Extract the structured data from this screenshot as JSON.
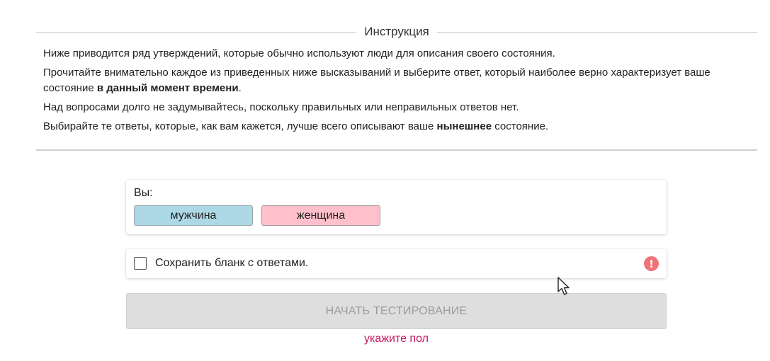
{
  "top_partial_text": "",
  "instruction": {
    "legend": "Инструкция",
    "p1": "Ниже приводится ряд утверждений, которые обычно используют люди для описания своего состояния.",
    "p2_before": "Прочитайте внимательно каждое из приведенных ниже высказываний и выберите ответ, который наиболее верно характеризует ваше состояние ",
    "p2_bold": "в данный момент времени",
    "p2_after": ".",
    "p3": "Над вопросами долго не задумывайтесь, поскольку правильных или неправильных ответов нет.",
    "p4_before": "Выбирайте те ответы, которые, как вам кажется, лучше всего описывают ваше ",
    "p4_bold": "нынешнее",
    "p4_after": " состояние."
  },
  "gender": {
    "label": "Вы:",
    "male_label": "мужчина",
    "female_label": "женщина",
    "male_color": "#add8e6",
    "female_color": "#ffc0cb"
  },
  "save_form": {
    "label": "Сохранить бланк с ответами.",
    "checked": false,
    "alert_icon": "exclamation-circle-icon",
    "alert_color": "#f07277"
  },
  "start": {
    "label": "НАЧАТЬ ТЕСТИРОВАНИЕ",
    "disabled": true
  },
  "hint": {
    "text": "укажите пол",
    "color": "#c2185b"
  }
}
